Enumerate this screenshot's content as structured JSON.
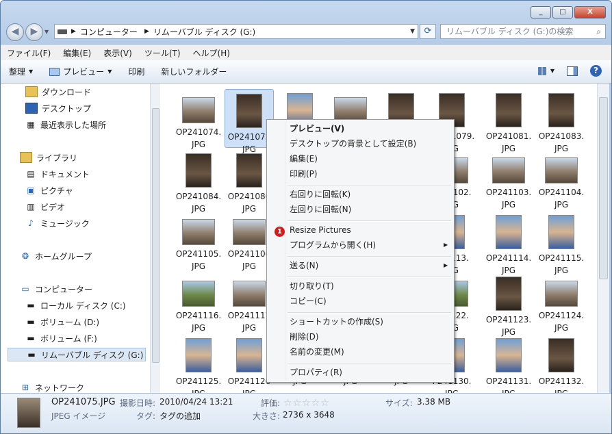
{
  "window": {
    "caption_buttons": [
      "_",
      "□",
      "X"
    ]
  },
  "address": {
    "crumbs": [
      "コンピューター",
      "リムーバブル ディスク (G:)"
    ],
    "search_placeholder": "リムーバブル ディスク (G:)の検索"
  },
  "menubar": [
    "ファイル(F)",
    "編集(E)",
    "表示(V)",
    "ツール(T)",
    "ヘルプ(H)"
  ],
  "cmdbar": {
    "organize": "整理",
    "preview": "プレビュー",
    "print": "印刷",
    "new_folder": "新しいフォルダー"
  },
  "nav": {
    "items": [
      {
        "label": "ダウンロード"
      },
      {
        "label": "デスクトップ"
      },
      {
        "label": "最近表示した場所"
      },
      {
        "label": "ライブラリ"
      },
      {
        "label": "ドキュメント"
      },
      {
        "label": "ピクチャ"
      },
      {
        "label": "ビデオ"
      },
      {
        "label": "ミュージック"
      },
      {
        "label": "ホームグループ"
      },
      {
        "label": "コンピューター"
      },
      {
        "label": "ローカル ディスク (C:)"
      },
      {
        "label": "ボリューム (D:)"
      },
      {
        "label": "ボリューム (F:)"
      },
      {
        "label": "リムーバブル ディスク (G:)"
      },
      {
        "label": "ネットワーク"
      }
    ]
  },
  "files": [
    {
      "name": "OP241074.",
      "ext": "JPG"
    },
    {
      "name": "OP241075",
      "ext": "JPG"
    },
    {
      "name": "",
      "ext": ""
    },
    {
      "name": "",
      "ext": ""
    },
    {
      "name": "",
      "ext": ""
    },
    {
      "name": "OP241079.",
      "ext": "JPG"
    },
    {
      "name": "OP241081.",
      "ext": "JPG"
    },
    {
      "name": "OP241083.",
      "ext": "JPG"
    },
    {
      "name": "OP241084.",
      "ext": "JPG"
    },
    {
      "name": "OP241086",
      "ext": "JPG"
    },
    {
      "name": "",
      "ext": ""
    },
    {
      "name": "",
      "ext": ""
    },
    {
      "name": "",
      "ext": ""
    },
    {
      "name": "P241102.",
      "ext": "JPG"
    },
    {
      "name": "OP241103.",
      "ext": "JPG"
    },
    {
      "name": "OP241104.",
      "ext": "JPG"
    },
    {
      "name": "OP241105.",
      "ext": "JPG"
    },
    {
      "name": "OP241106",
      "ext": "JPG"
    },
    {
      "name": "",
      "ext": ""
    },
    {
      "name": "",
      "ext": ""
    },
    {
      "name": "",
      "ext": ""
    },
    {
      "name": "241113.",
      "ext": "JPG"
    },
    {
      "name": "OP241114.",
      "ext": "JPG"
    },
    {
      "name": "OP241115.",
      "ext": "JPG"
    },
    {
      "name": "OP241116.",
      "ext": "JPG"
    },
    {
      "name": "OP241117",
      "ext": "JPG"
    },
    {
      "name": "",
      "ext": ""
    },
    {
      "name": "",
      "ext": ""
    },
    {
      "name": "",
      "ext": ""
    },
    {
      "name": "241122.",
      "ext": "JPG"
    },
    {
      "name": "OP241123.",
      "ext": "JPG"
    },
    {
      "name": "OP241124.",
      "ext": "JPG"
    },
    {
      "name": "OP241125.",
      "ext": "JPG"
    },
    {
      "name": "OP241126",
      "ext": "JPG"
    },
    {
      "name": "",
      "ext": "JPG"
    },
    {
      "name": "",
      "ext": "JPG"
    },
    {
      "name": "",
      "ext": "JPG"
    },
    {
      "name": "P241130.",
      "ext": "JPG"
    },
    {
      "name": "OP241131.",
      "ext": "JPG"
    },
    {
      "name": "OP241132.",
      "ext": "JPG"
    }
  ],
  "context_menu": {
    "items": [
      {
        "label": "プレビュー(V)"
      },
      {
        "label": "デスクトップの背景として設定(B)"
      },
      {
        "label": "編集(E)"
      },
      {
        "label": "印刷(P)"
      },
      {
        "label": "右回りに回転(K)"
      },
      {
        "label": "左回りに回転(N)"
      },
      {
        "label": "Resize Pictures"
      },
      {
        "label": "プログラムから開く(H)"
      },
      {
        "label": "送る(N)"
      },
      {
        "label": "切り取り(T)"
      },
      {
        "label": "コピー(C)"
      },
      {
        "label": "ショートカットの作成(S)"
      },
      {
        "label": "削除(D)"
      },
      {
        "label": "名前の変更(M)"
      },
      {
        "label": "プロパティ(R)"
      }
    ],
    "badge": "1"
  },
  "details": {
    "filename": "OP241075.JPG",
    "filetype": "JPEG イメージ",
    "date_label": "撮影日時:",
    "date_value": "2010/04/24 13:21",
    "tag_label": "タグ:",
    "tag_value": "タグの追加",
    "rating_label": "評価:",
    "size_label": "大きさ:",
    "size_value": "2736 x 3648",
    "filesize_label": "サイズ:",
    "filesize_value": "3.38 MB"
  }
}
